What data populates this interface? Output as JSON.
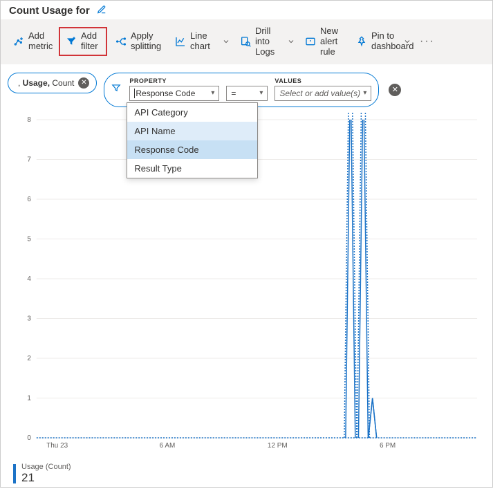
{
  "header": {
    "title": "Count Usage for"
  },
  "toolbar": {
    "add_metric": "Add metric",
    "add_filter": "Add filter",
    "apply_splitting": "Apply splitting",
    "line_chart": "Line chart",
    "drill_logs": "Drill into Logs",
    "new_alert": "New alert rule",
    "pin_dash": "Pin to dashboard"
  },
  "metric_pill": {
    "prefix": ", ",
    "metric": "Usage,",
    "agg": " Count"
  },
  "filter": {
    "property_label": "PROPERTY",
    "property_value": "Response Code",
    "operator": "=",
    "values_label": "VALUES",
    "values_placeholder": "Select or add value(s)",
    "options": [
      {
        "label": "API Category",
        "state": ""
      },
      {
        "label": "API Name",
        "state": "hover"
      },
      {
        "label": "Response Code",
        "state": "sel"
      },
      {
        "label": "Result Type",
        "state": ""
      }
    ]
  },
  "chart_data": {
    "type": "line",
    "y_ticks": [
      0,
      1,
      2,
      3,
      4,
      5,
      6,
      7,
      8
    ],
    "ylim": [
      0,
      8
    ],
    "x_ticks": [
      "Thu 23",
      "6 AM",
      "12 PM",
      "6 PM"
    ],
    "x_range_hours": 24,
    "baseline": 0,
    "spikes": [
      {
        "x_hour": 17.1,
        "y": 10,
        "clipped": true
      },
      {
        "x_hour": 17.8,
        "y": 10,
        "clipped": true
      },
      {
        "x_hour": 18.3,
        "y": 1
      }
    ]
  },
  "legend": {
    "name": "Usage (Count)",
    "value": "21"
  }
}
